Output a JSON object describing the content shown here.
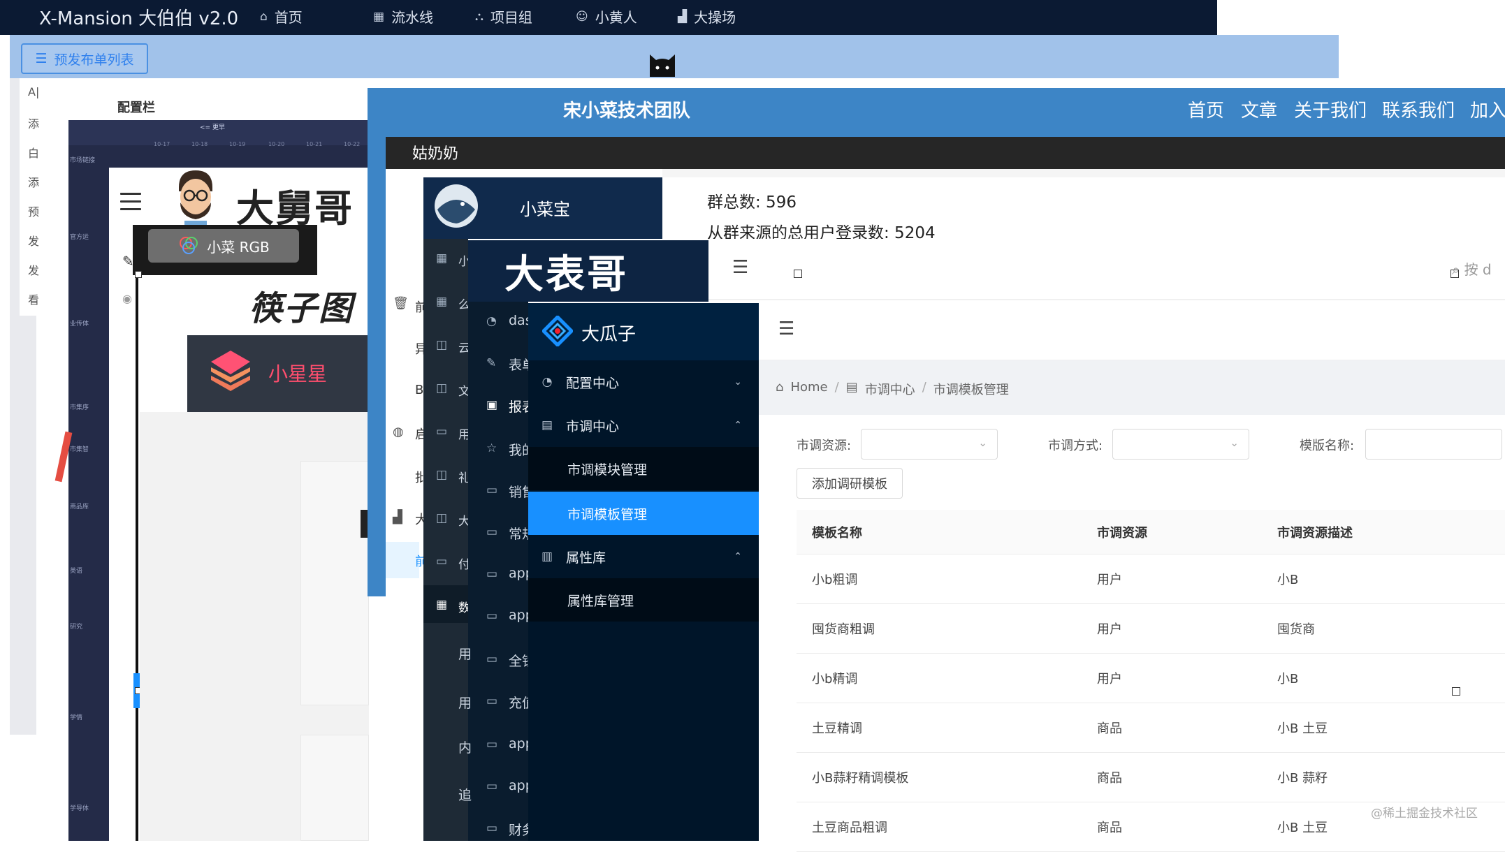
{
  "layer1": {
    "app_title": "X-Mansion 大伯伯 v2.0",
    "nav": [
      {
        "label": "首页",
        "icon": "home-icon"
      },
      {
        "label": "流水线",
        "icon": "grid-icon"
      },
      {
        "label": "项目组",
        "icon": "cluster-icon"
      },
      {
        "label": "小黄人",
        "icon": "smile-icon"
      },
      {
        "label": "大操场",
        "icon": "chart-icon"
      }
    ]
  },
  "layer2": {
    "list_button": "预发布单列表",
    "side_items": [
      "A|",
      "添",
      "白",
      "添",
      "预",
      "发",
      "发",
      "看"
    ],
    "config_label": "配置栏"
  },
  "layer3": {
    "hint": "<= 更早",
    "date_ticks": [
      "10-17",
      "10-18",
      "10-19",
      "10-20",
      "10-21",
      "10-22"
    ],
    "row_labels": [
      "市场链接",
      "官方运",
      "业传体",
      "市集序",
      "市集智",
      "商品库",
      "英语",
      "研究",
      "学情",
      "学导体"
    ]
  },
  "layer4": {
    "brand": "大舅哥",
    "rgb_label": "小菜 RGB",
    "calligraphy": "筷子图",
    "star_name": "小星星"
  },
  "layer5": {
    "title": "宋小菜技术团队",
    "nav": [
      "首页",
      "文章",
      "关于我们",
      "联系我们",
      "加入"
    ]
  },
  "layer6": {
    "title": "姑奶奶",
    "side_items": [
      {
        "icon": "trash-icon",
        "text": "前"
      },
      {
        "icon": "",
        "text": "异"
      },
      {
        "icon": "",
        "text": "B"
      },
      {
        "icon": "globe-icon",
        "text": "启"
      },
      {
        "icon": "",
        "text": "批"
      },
      {
        "icon": "chart-icon",
        "text": "大"
      },
      {
        "icon": "",
        "text": "前"
      }
    ]
  },
  "layer7": {
    "title": "小菜宝",
    "stat_groups": "群总数: 596",
    "stat_logins": "从群来源的总用户登录数: 5204",
    "side_items": [
      {
        "icon": "grid-icon",
        "text": "小"
      },
      {
        "icon": "grid-icon",
        "text": "么"
      },
      {
        "icon": "layout-icon",
        "text": "云"
      },
      {
        "icon": "layout-icon",
        "text": "文"
      },
      {
        "icon": "card-icon",
        "text": "用"
      },
      {
        "icon": "layout-icon",
        "text": "礼"
      },
      {
        "icon": "layout-icon",
        "text": "大"
      },
      {
        "icon": "card-icon",
        "text": "付"
      },
      {
        "icon": "table-icon",
        "text": "数"
      }
    ]
  },
  "layer8": {
    "title": "大表哥",
    "search_placeholder": "按 d",
    "side_items": [
      {
        "icon": "dashboard-icon",
        "text": "das"
      },
      {
        "icon": "edit-icon",
        "text": "表单"
      },
      {
        "icon": "file-icon",
        "text": "报表"
      },
      {
        "icon": "star-icon",
        "text": "我的"
      },
      {
        "icon": "folder-icon",
        "text": "销售"
      },
      {
        "icon": "folder-icon",
        "text": "常规"
      },
      {
        "icon": "folder-icon",
        "text": "app"
      },
      {
        "icon": "folder-icon",
        "text": "app"
      },
      {
        "icon": "folder-icon",
        "text": "全钱"
      },
      {
        "icon": "folder-icon",
        "text": "充值"
      },
      {
        "icon": "folder-icon",
        "text": "app"
      },
      {
        "icon": "folder-icon",
        "text": "app"
      },
      {
        "icon": "folder-icon",
        "text": "财务"
      }
    ],
    "left_chars": [
      "用",
      "用",
      "内",
      "追"
    ]
  },
  "layer9": {
    "title": "大瓜子",
    "menu": [
      {
        "type": "group",
        "icon": "dashboard-icon",
        "label": "配置中心",
        "arrow": "chevron-down-icon"
      },
      {
        "type": "group",
        "icon": "form-icon",
        "label": "市调中心",
        "arrow": "chevron-up-icon"
      },
      {
        "type": "sub",
        "label": "市调模块管理",
        "active": false
      },
      {
        "type": "sub",
        "label": "市调模板管理",
        "active": true
      },
      {
        "type": "group",
        "icon": "book-icon",
        "label": "属性库",
        "arrow": "chevron-up-icon"
      },
      {
        "type": "sub",
        "label": "属性库管理",
        "active": false
      }
    ],
    "breadcrumb": [
      "Home",
      "市调中心",
      "市调模板管理"
    ],
    "filters": {
      "source_label": "市调资源:",
      "method_label": "市调方式:",
      "name_label": "模版名称:"
    },
    "add_button": "添加调研模板",
    "table": {
      "headers": [
        "模板名称",
        "市调资源",
        "市调资源描述"
      ],
      "rows": [
        [
          "小b粗调",
          "用户",
          "小B"
        ],
        [
          "囤货商粗调",
          "用户",
          "囤货商"
        ],
        [
          "小b精调",
          "用户",
          "小B"
        ],
        [
          "土豆精调",
          "商品",
          "小B 土豆"
        ],
        [
          "小B蒜籽精调模板",
          "商品",
          "小B 蒜籽"
        ],
        [
          "土豆商品粗调",
          "商品",
          "小B 土豆"
        ]
      ]
    },
    "watermark": "@稀土掘金技术社区"
  },
  "colors": {
    "nav_dark": "#0b1a33",
    "light_blue": "#a1c2ea",
    "team_blue": "#3d85c6",
    "antd_dark": "#001529",
    "antd_primary": "#1890ff",
    "star_pink": "#ff4e6e"
  }
}
